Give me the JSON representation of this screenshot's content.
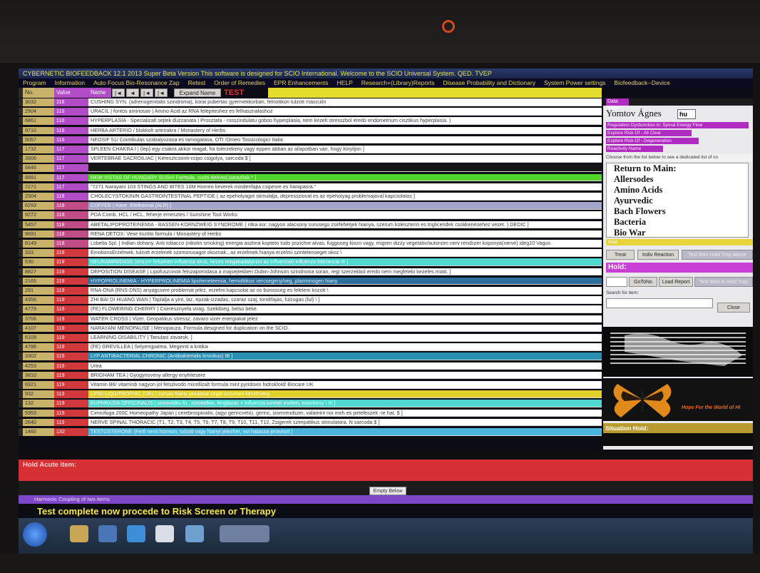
{
  "window": {
    "title": "CYBERNETIC BIOFEEDBACK 12.1 2013 Super Beta Version This software is designed for SCIO International. Welcome to the SCIO Universal System. QED. TVEP"
  },
  "menu": [
    "Program",
    "Information",
    "Auto Focus Bio-Resonance Zap",
    "Retest",
    "Order of Remedies",
    "EPR Enhancements",
    "HELP",
    "Research+(Library)Reports",
    "Disease Probability and Dictionary",
    "System Power settings",
    "Biofeedback--Device"
  ],
  "grid_header": {
    "no": "No.",
    "value": "Value",
    "name": "Name",
    "nav": [
      "|◄",
      "◄",
      "|◄",
      "|◄"
    ],
    "expand": "Expand Name",
    "test": "TEST"
  },
  "rows": [
    {
      "no": "3032",
      "value": "116",
      "value_color": "#b14bc6",
      "name_bg": "#ffffff",
      "name_color": "#3a3a3a",
      "name": "CUSHING SYN. (adrenogenitalis szindroma), korai pubertas gyermekkorban, felnottkori tulzott masculin"
    },
    {
      "no": "2904",
      "value": "116",
      "value_color": "#b14bc6",
      "name_bg": "#ffffff",
      "name_color": "#3a3a3a",
      "name": "URACIL | fontos aminosav | Amino Acid az RNA felepiteshez es felhasznalashoz"
    },
    {
      "no": "6861",
      "value": "116",
      "value_color": "#b14bc6",
      "name_bg": "#ffffff",
      "name_color": "#3a3a3a",
      "name": "HYPERPLASIA - Specializalt sejtek duzzanata | Prosztata - rosszindulatu gobos hyperplasia, nem kezelt stresszbol eredo endometrium cisztikus hyperplasia. )"
    },
    {
      "no": "9710",
      "value": "116",
      "value_color": "#b14bc6",
      "name_bg": "#ffffff",
      "name_color": "#3a3a3a",
      "name": "HERBA ARTERIO / blokkolt arteriakra / Monastery of Herbs"
    },
    {
      "no": "5057",
      "value": "116",
      "value_color": "#b14bc6",
      "name_bg": "#ffffff",
      "name_color": "#3a3a3a",
      "name": "NEOSIF 51/ Cointikulas szabalyozasa es tamogatasa, OTI /Omeo Tossicologici Italia"
    },
    {
      "no": "1732",
      "value": "117",
      "value_color": "#b14bc6",
      "name_bg": "#ffffff",
      "name_color": "#3a3a3a",
      "name": "SPLEEN CHAKRA I | (lep) egy csakra akkor reagal, ha tulerzekeny vagy eppen abban az allapotban van, hogy kinyiljon ]"
    },
    {
      "no": "3606",
      "value": "117",
      "value_color": "#b14bc6",
      "name_bg": "#ffffff",
      "name_color": "#3a3a3a",
      "name": "VERTEBRAE SACROILIAC | Keresztcsonti-csipo csigolya, sarcoda $ ]"
    },
    {
      "no": "6846",
      "value": "117",
      "value_color": "#b14bc6",
      "name_bg": "#151515",
      "name_color": "#151515",
      "name": ""
    },
    {
      "no": "8891",
      "value": "117",
      "value_color": "#b14bc6",
      "name_bg": "#4fd42c",
      "name_color": "#eaffdf",
      "name": "NEW VISTAS OF HUNGARY SUSHI Formula. sushi derived parazitak * ]"
    },
    {
      "no": "7271",
      "value": "117",
      "value_color": "#b14bc6",
      "name_bg": "#ffffff",
      "name_color": "#3a3a3a",
      "name": "\"7271 Narayani 103 STINGS AND BITES 10M Homeo keverek mindenfajta csipesre es harapasra.\""
    },
    {
      "no": "2504",
      "value": "118",
      "value_color": "#b14bc6",
      "name_bg": "#ffffff",
      "name_color": "#3a3a3a",
      "name": "CHOLECYSTOKININ GASTROINTESTINAL PEPTIDE ( az epeholyagot stimulalja, depresszioval es az epeholyag problemajaval kapcsolatos ]"
    },
    {
      "no": "8293",
      "value": "118",
      "value_color": "#c24c86",
      "name_bg": "#a4a6c9",
      "name_color": "#f5f5ff",
      "name": "COFFEE | Kave. Etelkovnal (ALR) ]"
    },
    {
      "no": "9272",
      "value": "118",
      "value_color": "#c24c86",
      "name_bg": "#ffffff",
      "name_color": "#3a3a3a",
      "name": "PDA Comb. HCL / HCL, feherje emesztes / Sunshine Tool Works"
    },
    {
      "no": "5457",
      "value": "118",
      "value_color": "#c24c86",
      "name_bg": "#ffffff",
      "name_color": "#3a3a3a",
      "name": "ABETALIPOPROTEINEMIA - BASSEN-KORNZWEIG SYNDROME ( ritka kor, nagyon alacsony surusegu zsirfeherjek hianya, szerum koleszterin es trigliceridek csokkenesehez vezet. ) DEDIC ]"
    },
    {
      "no": "9691",
      "value": "118",
      "value_color": "#c24c86",
      "name_bg": "#ffffff",
      "name_color": "#3a3a3a",
      "name": "RENA DETOX: Vese tisztito formula / Monastery of Herbs"
    },
    {
      "no": "8149",
      "value": "118",
      "value_color": "#c24c86",
      "name_bg": "#ffffff",
      "name_color": "#3a3a3a",
      "name": "Lobelia Spl. | Indian dohany. Anti tobacco (nikotin smoking) energia asztma kopteto tudo pszichre alvas, fuggoseg kinzo vagy, migren dizzy vegetativ/autonom nerv rendszer koponya(nerve) ideg10 Vagus"
    },
    {
      "no": "333",
      "value": "119",
      "value_color": "#d2393c",
      "name_bg": "#ffffff",
      "name_color": "#3a3a3a",
      "name": "EmotionsErzelmek, tulzott erzelmek szomorusagot okoznak., az erzelmek hianya erzelmi szintelenseget okoz \\"
    },
    {
      "no": "530",
      "value": "119",
      "value_color": "#d2393c",
      "name_bg": "#4fd8cf",
      "name_color": "#f3ffff",
      "name": "NEURAMINIDASE (enzym felszinen influenza virus, kezes megakadalyozni az influenzat) influenza tolerancia III ]"
    },
    {
      "no": "8827",
      "value": "119",
      "value_color": "#d2393c",
      "name_bg": "#ffffff",
      "name_color": "#3a3a3a",
      "name": "DEPOSITION DISEASE | Lipofuszcinok felszaporodasa a majsejtekben Dubin-Johnson szindroma soran, regi szerzekbol eredo nem megfelelo kezeles miatt. ]"
    },
    {
      "no": "2165",
      "value": "119",
      "value_color": "#d2393c",
      "name_bg": "#2d6f9c",
      "name_color": "#dbeeff",
      "name": "HYPOPROLINEMIA - HYPERPROLINEMIA lipoheneteemia, hemolitikus vercsegeny/veg, plazminogen hiany"
    },
    {
      "no": "291",
      "value": "119",
      "value_color": "#d2393c",
      "name_bg": "#ffffff",
      "name_color": "#3a3a3a",
      "name": "RNA-DNA (RNS-DNS) anyagcsere problemat jelez, erzelmi kapcsolat az os bunosseg es felelem kozott \\"
    },
    {
      "no": "4356",
      "value": "119",
      "value_color": "#d2393c",
      "name_bg": "#ffffff",
      "name_color": "#3a3a3a",
      "name": "ZHI BAI DI HUANG WAN | Taplalja a yint, laz, epzak-izzadas, szaraz szaj, torokfajas, fulzugas (ful) \\ ]"
    },
    {
      "no": "4779",
      "value": "119",
      "value_color": "#d2393c",
      "name_bg": "#ffffff",
      "name_color": "#3a3a3a",
      "name": "(FE) FLOWERING CHERRY | Cseresznyefa virag. Szelidseg, belso beke."
    },
    {
      "no": "3706",
      "value": "119",
      "value_color": "#d2393c",
      "name_bg": "#ffffff",
      "name_color": "#3a3a3a",
      "name": "WATER CROSS | Vizer. Geopatikus stressz, zavaro vizer energiakat jelez"
    },
    {
      "no": "4107",
      "value": "119",
      "value_color": "#d2393c",
      "name_bg": "#ffffff",
      "name_color": "#3a3a3a",
      "name": "NARAYANI MENOPAUSE | Menopauza. Formula designed for duplication on the SCIO."
    },
    {
      "no": "6109",
      "value": "119",
      "value_color": "#d2393c",
      "name_bg": "#ffffff",
      "name_color": "#3a3a3a",
      "name": "LEARNING DISABILITY | Tanulasi zavarok. ]"
    },
    {
      "no": "4788",
      "value": "119",
      "value_color": "#d2393c",
      "name_bg": "#ffffff",
      "name_color": "#3a3a3a",
      "name": "(FE) GREVILLEA | Selyemjpalma. Megeinti a kritika"
    },
    {
      "no": "3302",
      "value": "119",
      "value_color": "#d2393c",
      "name_bg": "#2b8fb4",
      "name_color": "#dff6ff",
      "name": "LYP ANTIBACTERIAL CHRONIC (Antibakterialis kronikus) IB ]"
    },
    {
      "no": "4253",
      "value": "119",
      "value_color": "#d2393c",
      "name_bg": "#ffffff",
      "name_color": "#3a3a3a",
      "name": "Urea"
    },
    {
      "no": "3810",
      "value": "119",
      "value_color": "#d2393c",
      "name_bg": "#ffffff",
      "name_color": "#3a3a3a",
      "name": "BRIGHAM TEA | Gyogynoveny allergy enyhitesere"
    },
    {
      "no": "6921",
      "value": "119",
      "value_color": "#d2393c",
      "name_bg": "#ffffff",
      "name_color": "#3a3a3a",
      "name": "Vitamin B6/ vitaminb nagyon jol felszivodo micellizalt formula mint pyridoxin hidrokloid/ Biocare UK"
    },
    {
      "no": "932",
      "value": "119",
      "value_color": "#d2393c",
      "name_bg": "#e1cf2c",
      "name_color": "#fffbe0",
      "name": "LIPID LIQUITROPHIC (DR) | zsirsav hiany javulasat segiti szoveteti kesztmeny"
    },
    {
      "no": "132",
      "value": "119",
      "value_color": "#d2393c",
      "name_bg": "#4fd8cf",
      "name_color": "#f3ffff",
      "name": "EUPHRASIA OFFICINALIS | szemviditu fu , szemelkie, fenglazac + influenza tunetei eseten, esterkeny \\ III ]"
    },
    {
      "no": "5953",
      "value": "119",
      "value_color": "#d2393c",
      "name_bg": "#ffffff",
      "name_color": "#3a3a3a",
      "name": "Cimicifuga 200C Homeopathy Japan | cerebrospinalis, (agyi gerincvelo), gerinc, izomrendszer, valamint noi meh es petefeszek -re hat. $ ]"
    },
    {
      "no": "2640",
      "value": "119",
      "value_color": "#d2393c",
      "name_bg": "#ffffff",
      "name_color": "#3a3a3a",
      "name": "NERVE SPINAL THORACIC (T1, T2, T3, T4, T5, T6, T7, T8, T9, T10, T11, T12, Zsigerek szimpatikus stimulatora. N sarcoda $ ]"
    },
    {
      "no": "1460",
      "value": "132",
      "value_color": "#d2393c",
      "name_bg": "#49b4dc",
      "name_color": "#e8f8ff",
      "name": "TESTOSTERONE (Ferfi nemi hormon, tulzott vagy hianyt jelezhet, noi hatassa jeravitott ]"
    }
  ],
  "side": {
    "data_label": "Data folder",
    "client_name": "Yomtov Ágnes",
    "lang_code": "hu",
    "links": [
      "Regulation Dysfunction in: Spinal Energy Flow",
      "Explore Risk Of - All Clear",
      "Explore Risk Of - Degeneration",
      "Reactivity Name"
    ],
    "choose_text": "Choose from the list below to see a dedicated list of co",
    "list": [
      "Return to Main:",
      "Allersodes",
      "Amino Acids",
      "Ayurvedic",
      "Bach Flowers",
      "Bacteria",
      "Bio War"
    ],
    "hold_small": "Hold",
    "treat": "Treat",
    "indiv_reaction": "Indiv Reaction",
    "test_hold_tray": "Test Item Hold Tray above",
    "hold_label": "Hold:",
    "gotono": "GoToNo",
    "load_report": "Load Report",
    "test_hold_item": "Test Item in Hold Tray",
    "search_label": "Search for item:",
    "close": "Close",
    "hope": "Hope For the World of HI",
    "situation_hold": "Situation Hold:"
  },
  "bottom": {
    "hold_acute": "Hold Acute item:",
    "empty_below": "Empty Below",
    "harmonic": "Harmonic Coupling of two items",
    "status": "Test complete now procede to Risk Screen or Therapy"
  },
  "icons": [
    "windows-start-icon",
    "file-explorer-icon",
    "media-player-icon",
    "internet-explorer-icon",
    "document-icon",
    "spreadsheet-icon",
    "scio-app-icon"
  ]
}
